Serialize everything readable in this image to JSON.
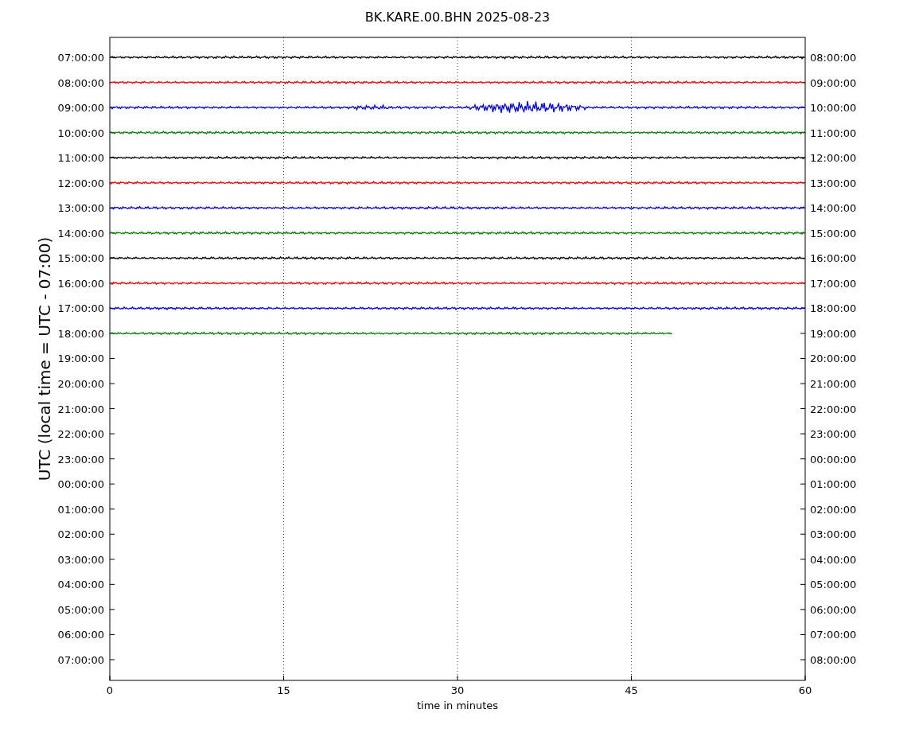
{
  "chart": {
    "title": "BK.KARE.00.BHN 2025-08-23",
    "ylabel": "UTC (local time = UTC - 07:00)",
    "xlabel": "time in minutes",
    "xticks": [
      "0",
      "15",
      "30",
      "45",
      "60"
    ],
    "left_labels": [
      "07:00:00",
      "08:00:00",
      "09:00:00",
      "10:00:00",
      "11:00:00",
      "12:00:00",
      "13:00:00",
      "14:00:00",
      "15:00:00",
      "16:00:00",
      "17:00:00",
      "18:00:00",
      "19:00:00",
      "20:00:00",
      "21:00:00",
      "22:00:00",
      "23:00:00",
      "00:00:00",
      "01:00:00",
      "02:00:00",
      "03:00:00",
      "04:00:00",
      "05:00:00",
      "06:00:00",
      "07:00:00"
    ],
    "right_labels": [
      "08:00:00",
      "09:00:00",
      "10:00:00",
      "11:00:00",
      "12:00:00",
      "13:00:00",
      "14:00:00",
      "15:00:00",
      "16:00:00",
      "17:00:00",
      "18:00:00",
      "19:00:00",
      "20:00:00",
      "21:00:00",
      "22:00:00",
      "23:00:00",
      "00:00:00",
      "01:00:00",
      "02:00:00",
      "03:00:00",
      "04:00:00",
      "05:00:00",
      "06:00:00",
      "07:00:00",
      "08:00:00"
    ],
    "traces": [
      {
        "color": "#000000",
        "level": 1
      },
      {
        "color": "#ff0000",
        "level": 1
      },
      {
        "color": "#0000ff",
        "level": 1
      },
      {
        "color": "#008000",
        "level": 1
      },
      {
        "color": "#000000",
        "level": 1
      },
      {
        "color": "#ff0000",
        "level": 1
      },
      {
        "color": "#0000ff",
        "level": 1
      },
      {
        "color": "#008000",
        "level": 1
      },
      {
        "color": "#000000",
        "level": 1
      },
      {
        "color": "#ff0000",
        "level": 1
      },
      {
        "color": "#0000ff",
        "level": 1
      },
      {
        "color": "#008000",
        "level": 0.81
      }
    ]
  }
}
